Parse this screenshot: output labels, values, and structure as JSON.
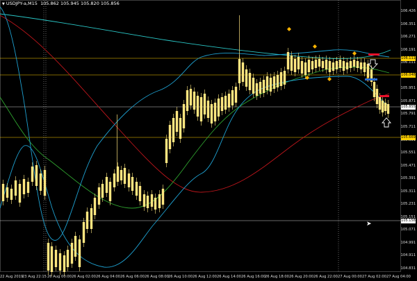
{
  "header": {
    "menu_icon": "triangle-down-icon",
    "symbol_label": "USDJPY-a,M15",
    "ohlc": "105.862 105.945 105.820 105.856"
  },
  "price_axis": {
    "ticks": [
      "106.426",
      "106.351",
      "106.271",
      "106.191",
      "106.111",
      "106.031",
      "105.951",
      "105.871",
      "105.791",
      "105.711",
      "105.631",
      "105.551",
      "105.471",
      "105.391",
      "105.311",
      "105.231",
      "105.151",
      "105.071",
      "104.991",
      "104.911",
      "104.831"
    ],
    "labels": [
      {
        "text": "106.111",
        "color": "#ffd000"
      },
      {
        "text": "106.048",
        "color": "#ffd000"
      },
      {
        "text": "105.855",
        "color": "#ffffff"
      },
      {
        "text": "105.669",
        "color": "#ffd000"
      },
      {
        "text": "105.158",
        "color": "#ffffff"
      }
    ]
  },
  "time_axis": {
    "labels": [
      "22 Aug 2019",
      "23 Aug 22:15",
      "26 Aug 00:00",
      "26 Aug 02:00",
      "26 Aug 04:00",
      "26 Aug 06:00",
      "26 Aug 08:00",
      "26 Aug 10:00",
      "26 Aug 12:00",
      "26 Aug 14:00",
      "26 Aug 16:00",
      "26 Aug 18:00",
      "26 Aug 20:00",
      "26 Aug 22:00",
      "27 Aug 00:00",
      "27 Aug 02:00",
      "27 Aug 04:00"
    ]
  },
  "colors": {
    "background": "#000000",
    "candle": "#ffe680",
    "grid_line": "#ffd000",
    "ma_red": "#c0161c",
    "ma_green": "#2fa22f",
    "ma_cyan": "#2ac8c8",
    "bands": "#1ea0d0",
    "marker": "#ffb400",
    "sell_mark": "#e8102a",
    "buy_mark": "#2a6ad0"
  },
  "icons": {
    "down_arrow": "down-arrow-icon",
    "up_arrow": "up-arrow-icon",
    "cursor": "mouse-cursor-icon"
  }
}
